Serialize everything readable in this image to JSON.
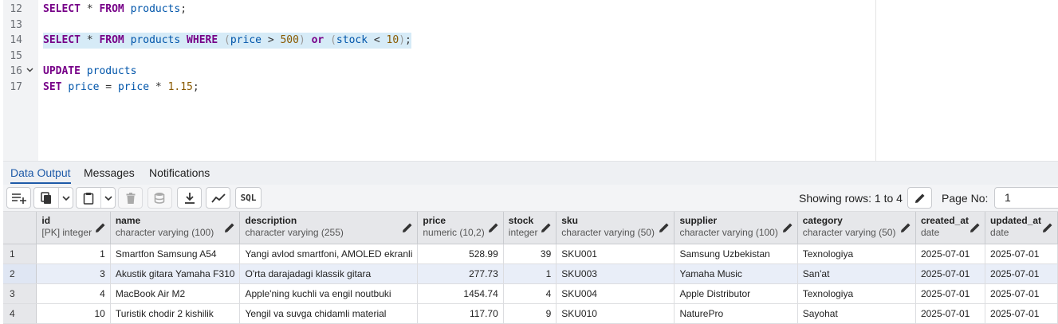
{
  "editor": {
    "lines": [
      {
        "n": "12",
        "fold": false,
        "highlight": false
      },
      {
        "n": "13",
        "fold": false,
        "highlight": false
      },
      {
        "n": "14",
        "fold": false,
        "highlight": true
      },
      {
        "n": "15",
        "fold": false,
        "highlight": false
      },
      {
        "n": "16",
        "fold": true,
        "highlight": false
      },
      {
        "n": "17",
        "fold": false,
        "highlight": false
      }
    ],
    "line12": {
      "kw1": "SELECT",
      "star": "*",
      "kw2": "FROM",
      "table": "products",
      "end": ";"
    },
    "line14": {
      "kw1": "SELECT",
      "star": "*",
      "kw2": "FROM",
      "table": "products",
      "kw3": "WHERE",
      "p1": "(",
      "col1": "price",
      "op1": ">",
      "v1": "500",
      "p2": ")",
      "kw4": "or",
      "p3": "(",
      "col2": "stock",
      "op2": "<",
      "v2": "10",
      "p4": ")",
      "end": ";"
    },
    "line16": {
      "kw1": "UPDATE",
      "table": "products"
    },
    "line17": {
      "kw1": "SET",
      "col1": "price",
      "op1": "=",
      "col2": "price",
      "op2": "*",
      "v1": "1.15",
      "end": ";"
    }
  },
  "tabs": [
    {
      "label": "Data Output",
      "active": true
    },
    {
      "label": "Messages",
      "active": false
    },
    {
      "label": "Notifications",
      "active": false
    }
  ],
  "toolbar": {
    "sql_label": "SQL",
    "showing_rows": "Showing rows: 1 to 4",
    "page_no_label": "Page No:",
    "page_no_value": "1"
  },
  "grid": {
    "columns": [
      {
        "name": "id",
        "type": "[PK] integer",
        "align": "right"
      },
      {
        "name": "name",
        "type": "character varying (100)",
        "align": "left"
      },
      {
        "name": "description",
        "type": "character varying (255)",
        "align": "left"
      },
      {
        "name": "price",
        "type": "numeric (10,2)",
        "align": "right"
      },
      {
        "name": "stock",
        "type": "integer",
        "align": "right"
      },
      {
        "name": "sku",
        "type": "character varying (50)",
        "align": "left"
      },
      {
        "name": "supplier",
        "type": "character varying (100)",
        "align": "left"
      },
      {
        "name": "category",
        "type": "character varying (50)",
        "align": "left"
      },
      {
        "name": "created_at",
        "type": "date",
        "align": "left"
      },
      {
        "name": "updated_at",
        "type": "date",
        "align": "left"
      }
    ],
    "rows": [
      {
        "rn": "1",
        "cells": [
          "1",
          "Smartfon Samsung A54",
          "Yangi avlod smartfoni, AMOLED ekranli",
          "528.99",
          "39",
          "SKU001",
          "Samsung Uzbekistan",
          "Texnologiya",
          "2025-07-01",
          "2025-07-01"
        ]
      },
      {
        "rn": "2",
        "cells": [
          "3",
          "Akustik gitara Yamaha F310",
          "O'rta darajadagi klassik gitara",
          "277.73",
          "1",
          "SKU003",
          "Yamaha Music",
          "San'at",
          "2025-07-01",
          "2025-07-01"
        ]
      },
      {
        "rn": "3",
        "cells": [
          "4",
          "MacBook Air M2",
          "Apple'ning kuchli va engil noutbuki",
          "1454.74",
          "4",
          "SKU004",
          "Apple Distributor",
          "Texnologiya",
          "2025-07-01",
          "2025-07-01"
        ]
      },
      {
        "rn": "4",
        "cells": [
          "10",
          "Turistik chodir 2 kishilik",
          "Yengil va suvga chidamli material",
          "117.70",
          "9",
          "SKU010",
          "NaturePro",
          "Sayohat",
          "2025-07-01",
          "2025-07-01"
        ]
      }
    ],
    "selected_row": 1
  }
}
